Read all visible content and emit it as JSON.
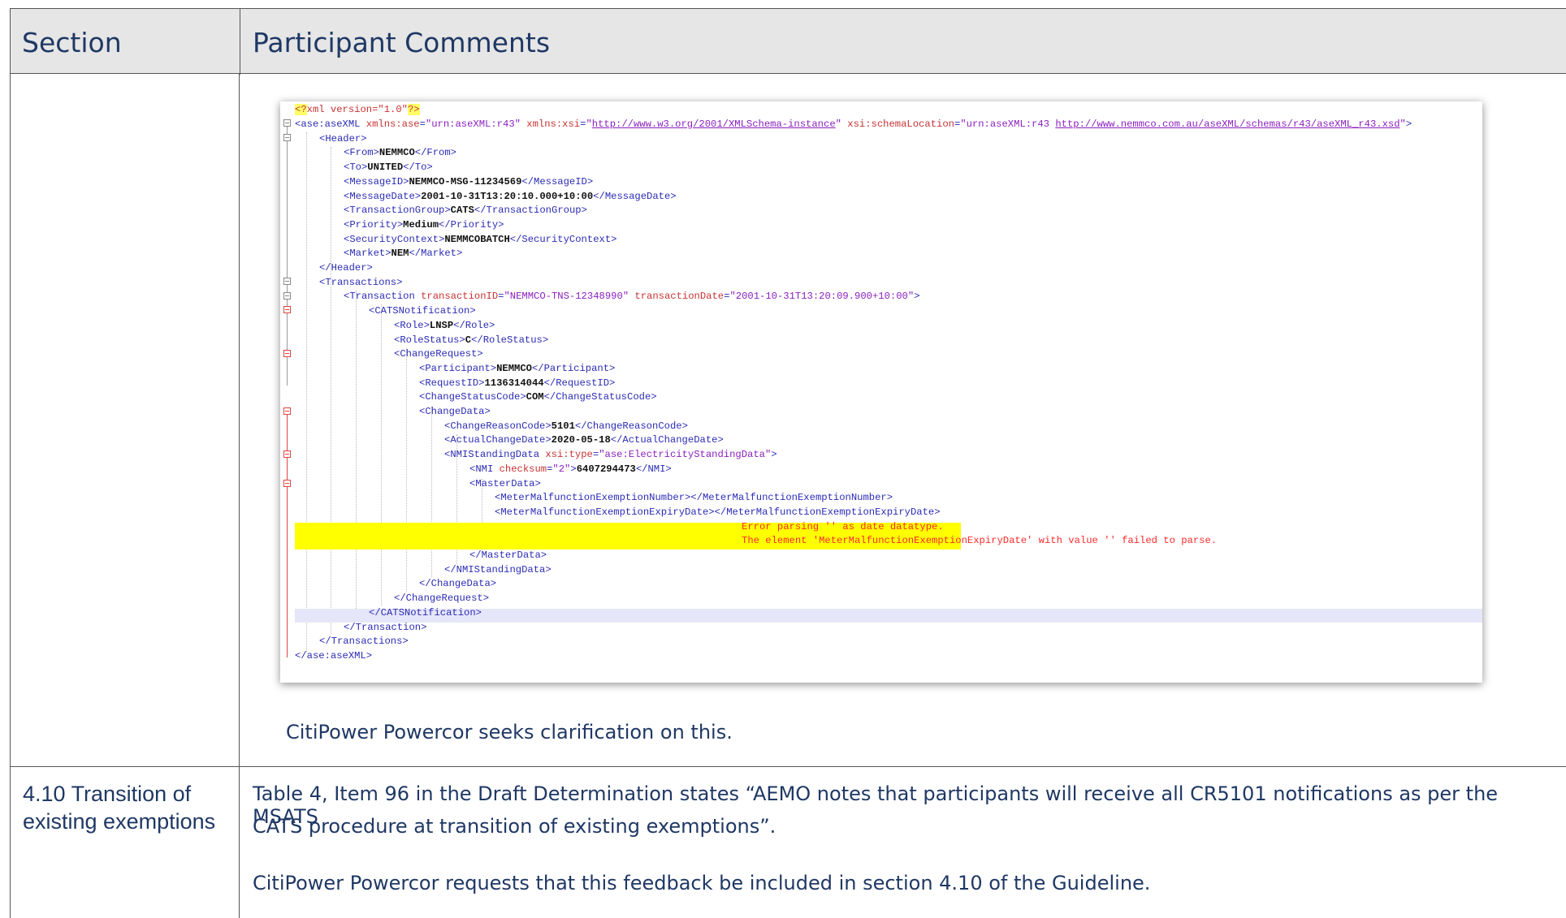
{
  "table": {
    "headers": {
      "section": "Section",
      "comments": "Participant Comments"
    },
    "row1": {
      "comment": "CitiPower Powercor seeks clarification on this."
    },
    "row2": {
      "section": "4.10 Transition of existing exemptions",
      "comment_p1_line1": "Table 4, Item 96 in the Draft Determination states “AEMO notes that participants will receive all CR5101 notifications as per the MSATS",
      "comment_p1_line2": "CATS procedure at transition of existing exemptions”.",
      "comment_p2": "CitiPower Powercor requests that this feedback be included in section 4.10 of the Guideline."
    }
  },
  "xml_screenshot": {
    "lines": [
      "<?xml version=\"1.0\"?>",
      "<ase:aseXML xmlns:ase=\"urn:aseXML:r43\" xmlns:xsi=\"http://www.w3.org/2001/XMLSchema-instance\" xsi:schemaLocation=\"urn:aseXML:r43 http://www.nemmco.com.au/aseXML/schemas/r43/aseXML_r43.xsd\">",
      "<Header>",
      "<From>NEMMCO</From>",
      "<To>UNITED</To>",
      "<MessageID>NEMMCO-MSG-11234569</MessageID>",
      "<MessageDate>2001-10-31T13:20:10.000+10:00</MessageDate>",
      "<TransactionGroup>CATS</TransactionGroup>",
      "<Priority>Medium</Priority>",
      "<SecurityContext>NEMMCOBATCH</SecurityContext>",
      "<Market>NEM</Market>",
      "</Header>",
      "<Transactions>",
      "<Transaction transactionID=\"NEMMCO-TNS-12348990\" transactionDate=\"2001-10-31T13:20:09.900+10:00\">",
      "<CATSNotification>",
      "<Role>LNSP</Role>",
      "<RoleStatus>C</RoleStatus>",
      "<ChangeRequest>",
      "<Participant>NEMMCO</Participant>",
      "<RequestID>1136314044</RequestID>",
      "<ChangeStatusCode>COM</ChangeStatusCode>",
      "<ChangeData>",
      "<ChangeReasonCode>5101</ChangeReasonCode>",
      "<ActualChangeDate>2020-05-18</ActualChangeDate>",
      "<NMIStandingData xsi:type=\"ase:ElectricityStandingData\">",
      "<NMI checksum=\"2\">6407294473</NMI>",
      "<MasterData>",
      "<MeterMalfunctionExemptionNumber></MeterMalfunctionExemptionNumber>",
      "<MeterMalfunctionExemptionExpiryDate></MeterMalfunctionExemptionExpiryDate>",
      "Error parsing '' as date datatype.",
      "The element 'MeterMalfunctionExemptionExpiryDate' with value '' failed to parse.",
      "</MasterData>",
      "</NMIStandingData>",
      "</ChangeData>",
      "</ChangeRequest>",
      "</CATSNotification>",
      "</Transaction>",
      "</Transactions>",
      "</ase:aseXML>"
    ]
  }
}
